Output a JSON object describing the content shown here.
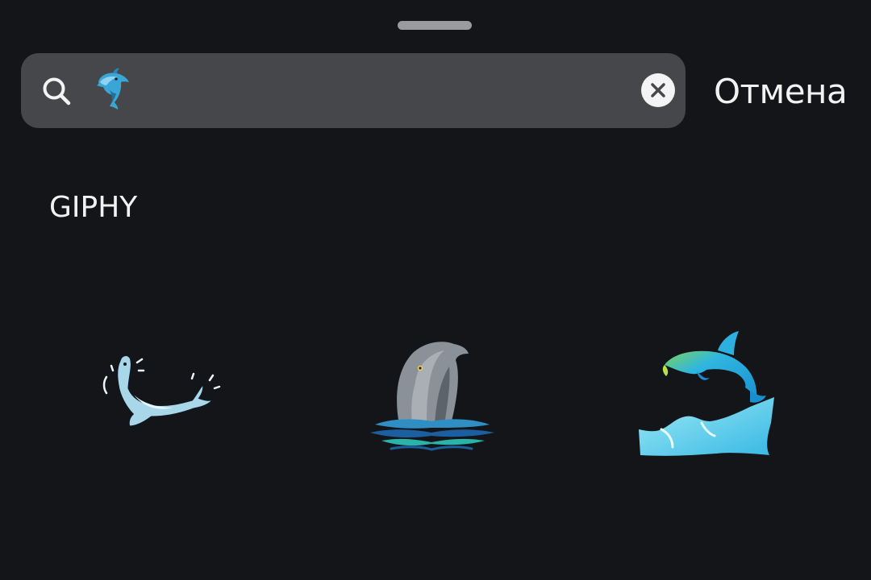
{
  "search": {
    "value": "🐬",
    "clear_icon": "close-icon",
    "search_icon": "search-icon"
  },
  "header": {
    "cancel_label": "Отмена"
  },
  "results": {
    "section_title": "GIPHY",
    "stickers": [
      {
        "description_icon": "dolphin-splash-sticker"
      },
      {
        "description_icon": "dolphin-head-water-sticker"
      },
      {
        "description_icon": "dolphin-jumping-wave-sticker"
      }
    ]
  },
  "colors": {
    "background": "#141519",
    "search_bar": "#46474a",
    "text": "#f2f2f2",
    "handle": "#9a9b9e"
  }
}
